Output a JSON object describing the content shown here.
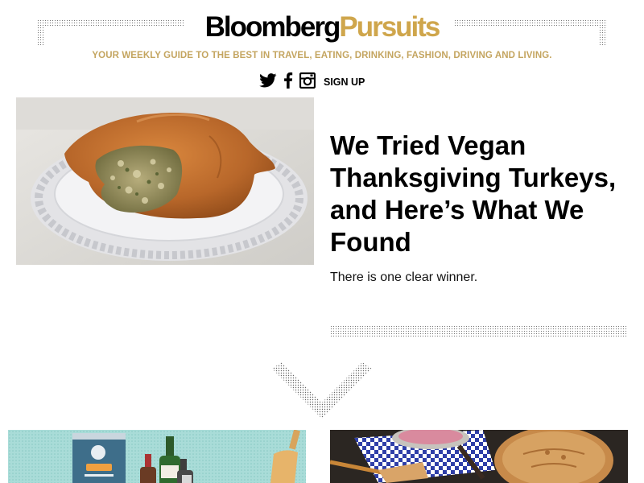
{
  "header": {
    "logo_part1": "Bloomberg",
    "logo_part2": "Pursuits",
    "tagline": "YOUR WEEKLY GUIDE TO THE BEST IN TRAVEL, EATING, DRINKING, FASHION, DRIVING AND LIVING.",
    "social_icons": [
      "twitter-icon",
      "facebook-icon",
      "instagram-icon"
    ],
    "signup_label": "SIGN UP"
  },
  "article": {
    "headline": "We Tried Vegan Thanksgiving Turkeys, and Here’s What We Found",
    "dek": "There is one clear winner."
  },
  "colors": {
    "brand_gold": "#cfa64c",
    "tagline_gold": "#c4a560",
    "text": "#000000"
  }
}
